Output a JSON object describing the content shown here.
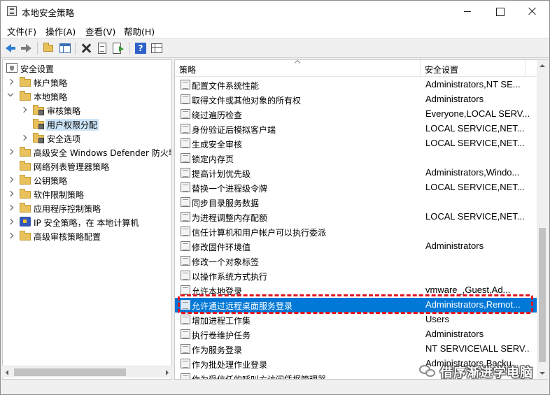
{
  "window": {
    "title": "本地安全策略",
    "controls": {
      "minimize": "minimize",
      "maximize": "maximize",
      "close": "close"
    }
  },
  "menu": [
    "文件(F)",
    "操作(A)",
    "查看(V)",
    "帮助(H)"
  ],
  "toolbar": {
    "buttons": [
      "back-arrow",
      "forward-arrow",
      "up-folder",
      "show-hide-tree",
      "delete",
      "properties",
      "export-list",
      "help",
      "view-grid"
    ]
  },
  "tree": {
    "items": [
      {
        "label": "安全设置",
        "icon": "shield-icon",
        "expander": "none"
      },
      {
        "label": "帐户策略",
        "icon": "folder-icon",
        "expander": "collapsed"
      },
      {
        "label": "本地策略",
        "icon": "folder-icon",
        "expander": "expanded"
      },
      {
        "label": "审核策略",
        "icon": "lock-folder-icon",
        "expander": "collapsed"
      },
      {
        "label": "用户权限分配",
        "icon": "lock-folder-icon",
        "expander": "none",
        "selected": true
      },
      {
        "label": "安全选项",
        "icon": "lock-folder-icon",
        "expander": "collapsed"
      },
      {
        "label": "高级安全 Windows Defender 防火墙",
        "icon": "folder-icon",
        "expander": "collapsed"
      },
      {
        "label": "网络列表管理器策略",
        "icon": "folder-icon",
        "expander": "none"
      },
      {
        "label": "公钥策略",
        "icon": "folder-icon",
        "expander": "collapsed"
      },
      {
        "label": "软件限制策略",
        "icon": "folder-icon",
        "expander": "collapsed"
      },
      {
        "label": "应用程序控制策略",
        "icon": "folder-icon",
        "expander": "collapsed"
      },
      {
        "label": "IP 安全策略，在 本地计算机",
        "icon": "ipsec-icon",
        "expander": "collapsed"
      },
      {
        "label": "高级审核策略配置",
        "icon": "folder-icon",
        "expander": "collapsed"
      }
    ]
  },
  "list": {
    "columns": [
      "策略",
      "安全设置"
    ],
    "rows": [
      {
        "name": "配置文件系统性能",
        "setting": "Administrators,NT SE..."
      },
      {
        "name": "取得文件或其他对象的所有权",
        "setting": "Administrators"
      },
      {
        "name": "绕过遍历检查",
        "setting": "Everyone,LOCAL SERV..."
      },
      {
        "name": "身份验证后模拟客户端",
        "setting": "LOCAL SERVICE,NET..."
      },
      {
        "name": "生成安全审核",
        "setting": "LOCAL SERVICE,NET..."
      },
      {
        "name": "锁定内存页",
        "setting": ""
      },
      {
        "name": "提高计划优先级",
        "setting": "Administrators,Windo..."
      },
      {
        "name": "替换一个进程级令牌",
        "setting": "LOCAL SERVICE,NET..."
      },
      {
        "name": "同步目录服务数据",
        "setting": ""
      },
      {
        "name": "为进程调整内存配额",
        "setting": "LOCAL SERVICE,NET..."
      },
      {
        "name": "信任计算机和用户帐户可以执行委派",
        "setting": ""
      },
      {
        "name": "修改固件环境值",
        "setting": "Administrators"
      },
      {
        "name": "修改一个对象标签",
        "setting": ""
      },
      {
        "name": "以操作系统方式执行",
        "setting": ""
      },
      {
        "name": "允许本地登录",
        "setting": "vmware_,Guest,Ad..."
      },
      {
        "name": "允许通过远程桌面服务登录",
        "setting": "Administrators,Remot...",
        "highlighted": true
      },
      {
        "name": "增加进程工作集",
        "setting": "Users"
      },
      {
        "name": "执行卷维护任务",
        "setting": "Administrators"
      },
      {
        "name": "作为服务登录",
        "setting": "NT SERVICE\\ALL SERV..."
      },
      {
        "name": "作为批处理作业登录",
        "setting": "Administrators,Backu..."
      },
      {
        "name": "作为受信任的呼叫方访问凭据管理器",
        "setting": ""
      }
    ]
  },
  "watermark": {
    "text": "借序渐进学电脑",
    "icon": "chat-bubbles-icon"
  },
  "colors": {
    "selection": "#0078d7",
    "tree_selection": "#cce4f7",
    "annotation_box": "#e0141e"
  }
}
